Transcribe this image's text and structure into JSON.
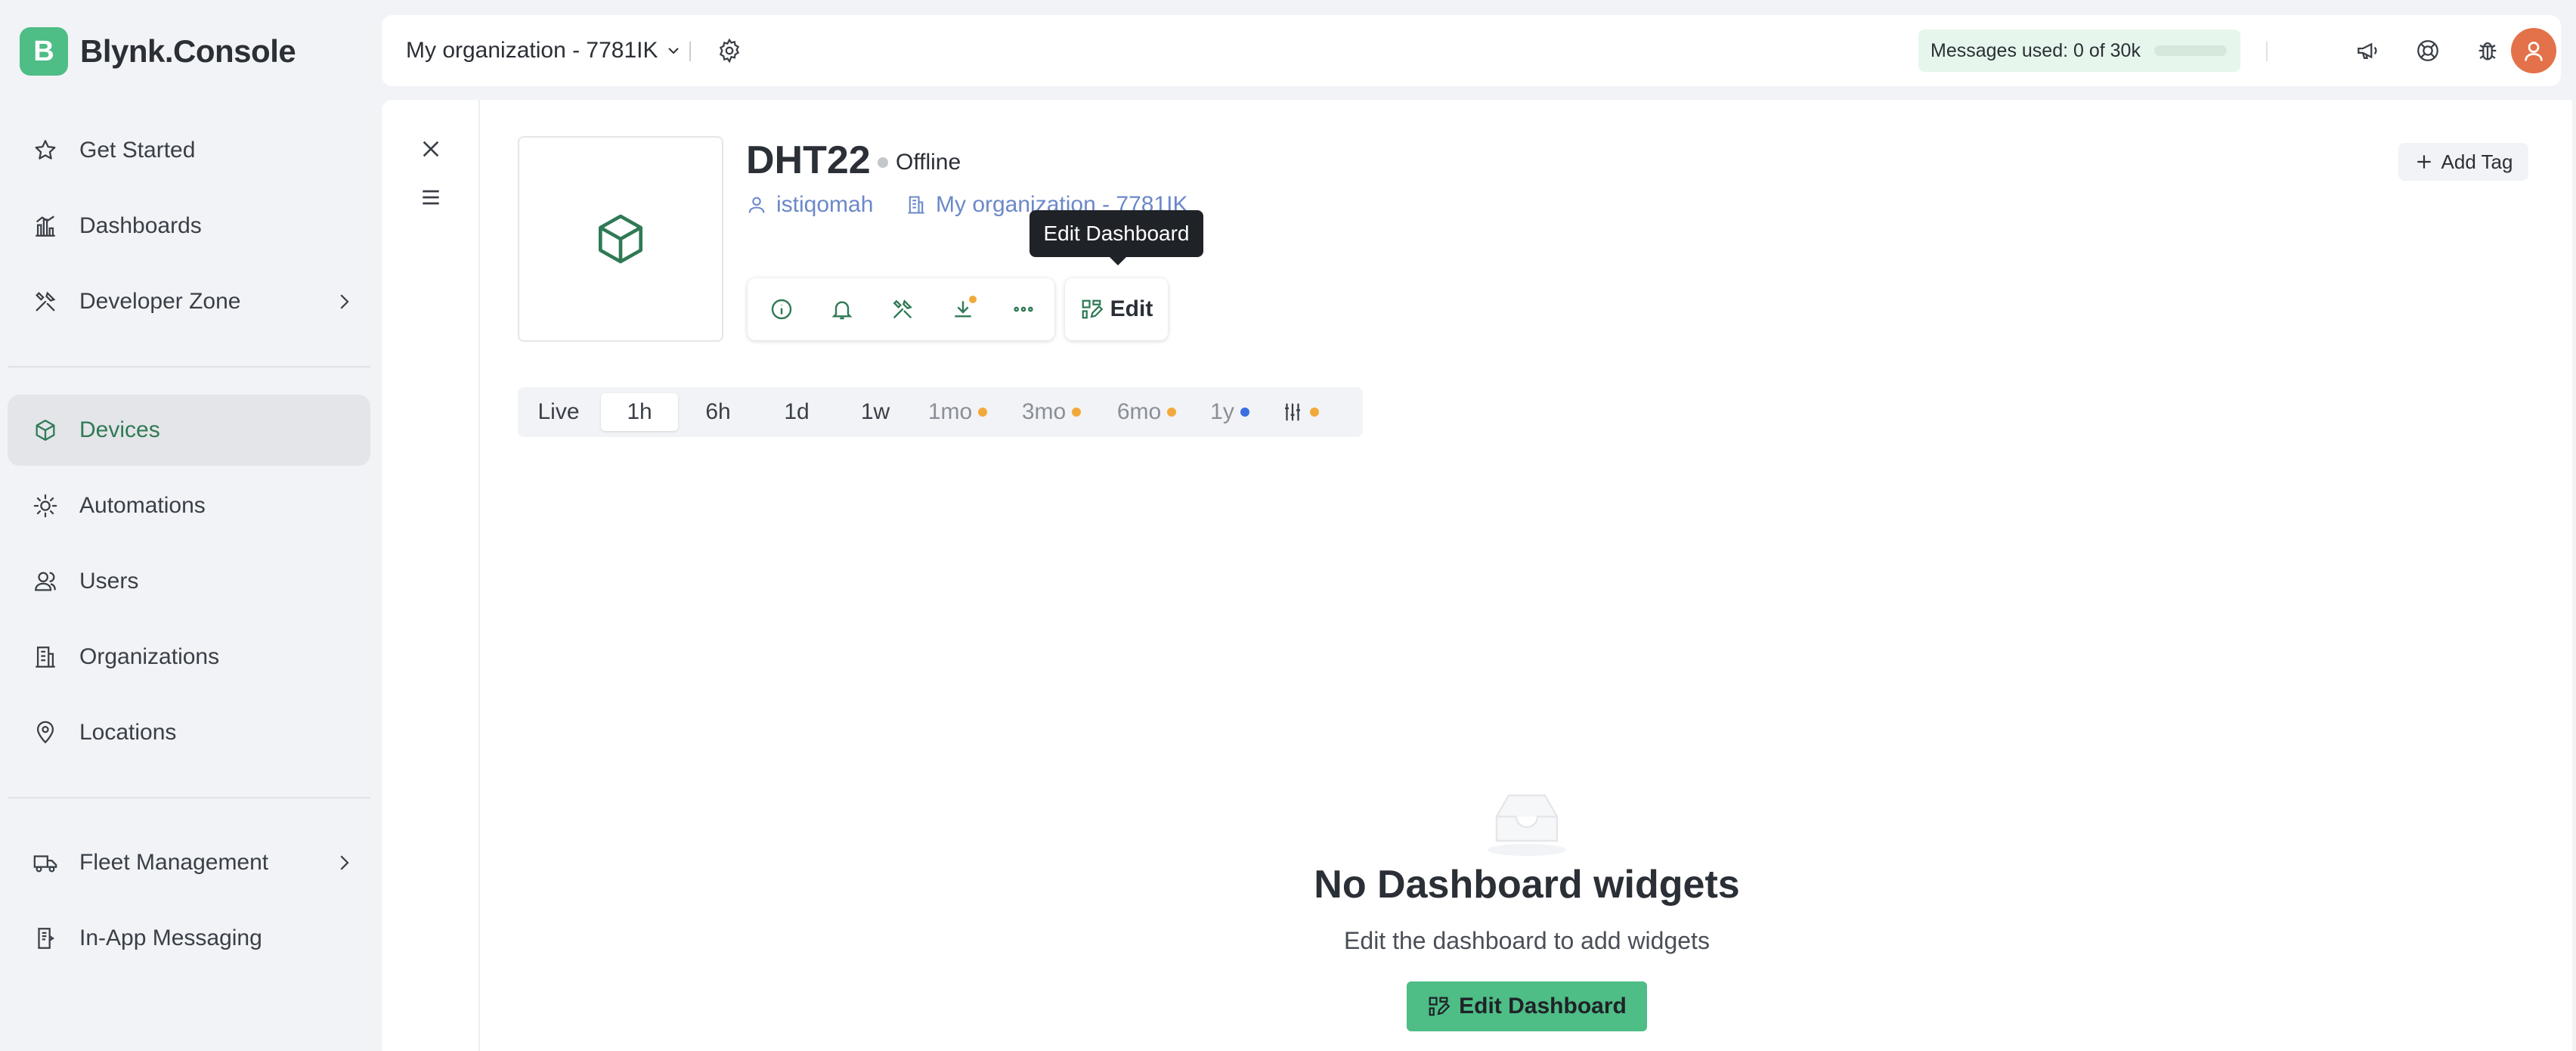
{
  "app": {
    "logo_letter": "B",
    "name": "Blynk.Console",
    "brand_color": "#4ebd86"
  },
  "sidebar": {
    "items": [
      {
        "label": "Get Started",
        "icon": "star-icon"
      },
      {
        "label": "Dashboards",
        "icon": "bar-chart-icon"
      },
      {
        "label": "Developer Zone",
        "icon": "tools-icon"
      },
      {
        "label": "Devices",
        "icon": "cube-icon",
        "active": true
      },
      {
        "label": "Automations",
        "icon": "sun-icon"
      },
      {
        "label": "Users",
        "icon": "users-icon"
      },
      {
        "label": "Organizations",
        "icon": "building-icon"
      },
      {
        "label": "Locations",
        "icon": "pin-icon"
      },
      {
        "label": "Fleet Management",
        "icon": "truck-icon"
      },
      {
        "label": "In-App Messaging",
        "icon": "message-icon"
      }
    ]
  },
  "topbar": {
    "org_name": "My organization - 7781IK",
    "messages_label": "Messages used: 0 of 30k",
    "messages_used_fraction": 0
  },
  "device": {
    "name": "DHT22",
    "status": "Offline",
    "owner": "istiqomah",
    "organization": "My organization - 7781IK",
    "tooltip": "Edit Dashboard",
    "edit_label": "Edit",
    "add_tag_label": "Add Tag"
  },
  "time_ranges": [
    {
      "label": "Live"
    },
    {
      "label": "1h",
      "selected": true
    },
    {
      "label": "6h"
    },
    {
      "label": "1d"
    },
    {
      "label": "1w"
    },
    {
      "label": "1mo",
      "dot_color": "#f2a93b"
    },
    {
      "label": "3mo",
      "dot_color": "#f2a93b"
    },
    {
      "label": "6mo",
      "dot_color": "#f2a93b"
    },
    {
      "label": "1y",
      "dot_color": "#3b6fe0"
    }
  ],
  "empty_state": {
    "title": "No Dashboard widgets",
    "subtitle": "Edit the dashboard to add widgets",
    "button_label": "Edit Dashboard"
  }
}
